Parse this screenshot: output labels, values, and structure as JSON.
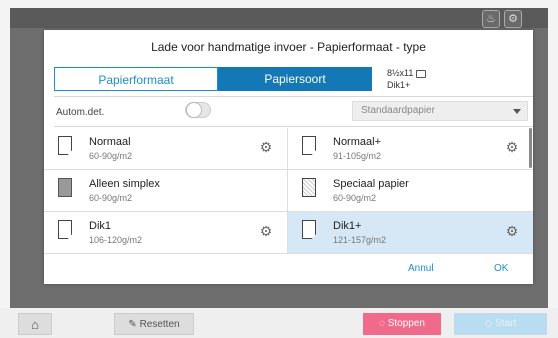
{
  "dialog": {
    "title": "Lade voor handmatige invoer - Papierformaat - type",
    "tabs": [
      {
        "label": "Papierformaat",
        "active": false
      },
      {
        "label": "Papiersoort",
        "active": true
      }
    ],
    "current_size": "8½x11",
    "current_type": "Dik1+",
    "auto_detect_label": "Autom.det.",
    "auto_detect_on": false,
    "dropdown_value": "Standaardpapier",
    "paper_types": [
      {
        "name": "Normaal",
        "weight": "60-90g/m2",
        "settings": true,
        "selected": false
      },
      {
        "name": "Normaal+",
        "weight": "91-105g/m2",
        "settings": true,
        "selected": false
      },
      {
        "name": "Alleen simplex",
        "weight": "60-90g/m2",
        "settings": false,
        "selected": false
      },
      {
        "name": "Speciaal papier",
        "weight": "60-90g/m2",
        "settings": false,
        "selected": false
      },
      {
        "name": "Dik1",
        "weight": "106-120g/m2",
        "settings": true,
        "selected": false
      },
      {
        "name": "Dik1+",
        "weight": "121-157g/m2",
        "settings": true,
        "selected": true
      }
    ],
    "cancel_label": "Annul",
    "ok_label": "OK"
  },
  "footer": {
    "reset_label": "Resetten",
    "stop_label": "Stoppen",
    "start_label": "Start"
  },
  "icons": [
    "bell-icon",
    "user-icon",
    "home-icon",
    "pencil-icon",
    "stop-icon",
    "start-icon",
    "settings-icon",
    "paper-icon"
  ],
  "colors": {
    "accent": "#1e8fc6",
    "tab_active": "#1478b6",
    "stop": "#f06b8b",
    "start": "#b9dcf1",
    "selected_row": "#d6e8f6"
  }
}
